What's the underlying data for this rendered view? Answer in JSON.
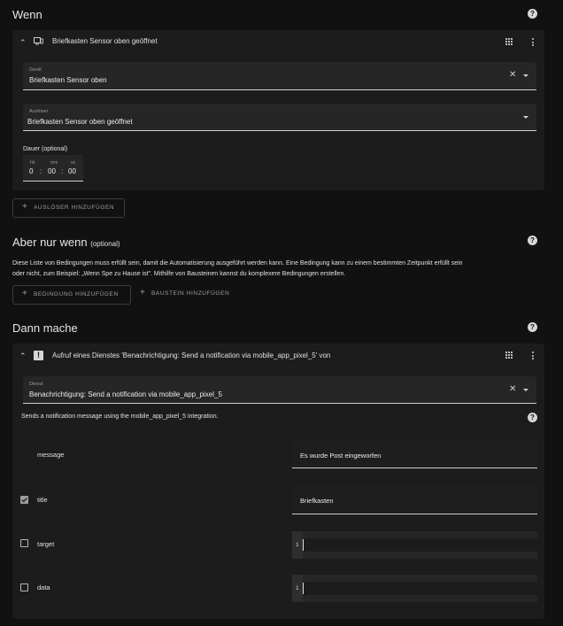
{
  "wenn": {
    "title": "Wenn",
    "trigger_card": {
      "title": "Briefkasten Sensor oben geöffnet",
      "device_label": "Gerät",
      "device_value": "Briefkasten Sensor oben",
      "trigger_label": "Auslöser",
      "trigger_value": "Briefkasten Sensor oben geöffnet",
      "duration_label": "Dauer (optional)",
      "hh_label": "hh",
      "mm_label": "mm",
      "ss_label": "ss",
      "hh_value": "0",
      "mm_value": "00",
      "ss_value": "00",
      "sep": ":"
    },
    "add_trigger_button": "AUSLÖSER HINZUFÜGEN"
  },
  "aber": {
    "title": "Aber nur wenn",
    "optional": "(optional)",
    "description_line1": "Diese Liste von Bedingungen muss erfüllt sein, damit die Automatisierung ausgeführt werden kann. Eine Bedingung kann zu einem bestimmten Zeitpunkt erfüllt sein",
    "description_line2": "oder nicht, zum Beispiel: „Wenn Spe zu Hause ist\". Mithilfe von Bausteinen kannst du komplexere Bedingungen erstellen.",
    "add_condition_button": "BEDINGUNG HINZUFÜGEN",
    "add_block_button": "BAUSTEIN HINZUFÜGEN"
  },
  "dann": {
    "title": "Dann mache",
    "action_card": {
      "title": "Aufruf eines Dienstes 'Benachrichtigung: Send a notification via mobile_app_pixel_5' von",
      "service_label": "Dienst",
      "service_value": "Benachrichtigung: Send a notification via mobile_app_pixel_5",
      "description": "Sends a notification message using the mobile_app_pixel_5 integration.",
      "params": [
        {
          "name": "message",
          "value": "Es wurde Post eingeworfen",
          "checked": null
        },
        {
          "name": "title",
          "value": "Briefkasten",
          "checked": true
        },
        {
          "name": "target",
          "line": "1",
          "checked": false
        },
        {
          "name": "data",
          "line": "1",
          "checked": false
        }
      ]
    }
  },
  "icons": {
    "help": "question-circle-icon",
    "plus": "plus-icon",
    "chevron": "chevron-up-icon",
    "device": "device-icon",
    "alert": "alert-box-icon",
    "drag": "drag-handle-icon",
    "menu": "dots-vertical-icon",
    "clear": "close-icon",
    "dropdown": "menu-down-icon"
  },
  "colors": {
    "background": "#111111",
    "card": "#1c1c1c",
    "field": "#262626"
  }
}
